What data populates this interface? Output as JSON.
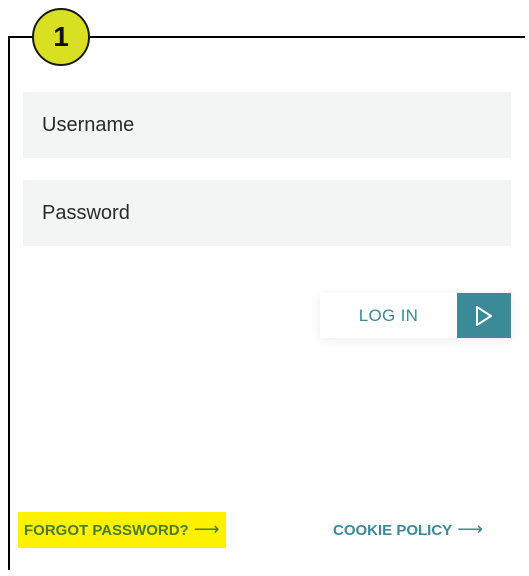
{
  "step_badge": {
    "number": "1"
  },
  "form": {
    "username_placeholder": "Username",
    "password_placeholder": "Password",
    "login_label": "LOG IN",
    "login_icon": "play-arrow-icon"
  },
  "footer": {
    "forgot_password_label": "FORGOT PASSWORD?",
    "cookie_policy_label": "COOKIE POLICY",
    "arrow_icon": "right-arrow-icon"
  },
  "colors": {
    "badge": "#d8e021",
    "accent_teal": "#3a8a98",
    "forgot_text": "#4a7d2a",
    "highlight": "#fff200",
    "field_bg": "#f3f5f5"
  }
}
